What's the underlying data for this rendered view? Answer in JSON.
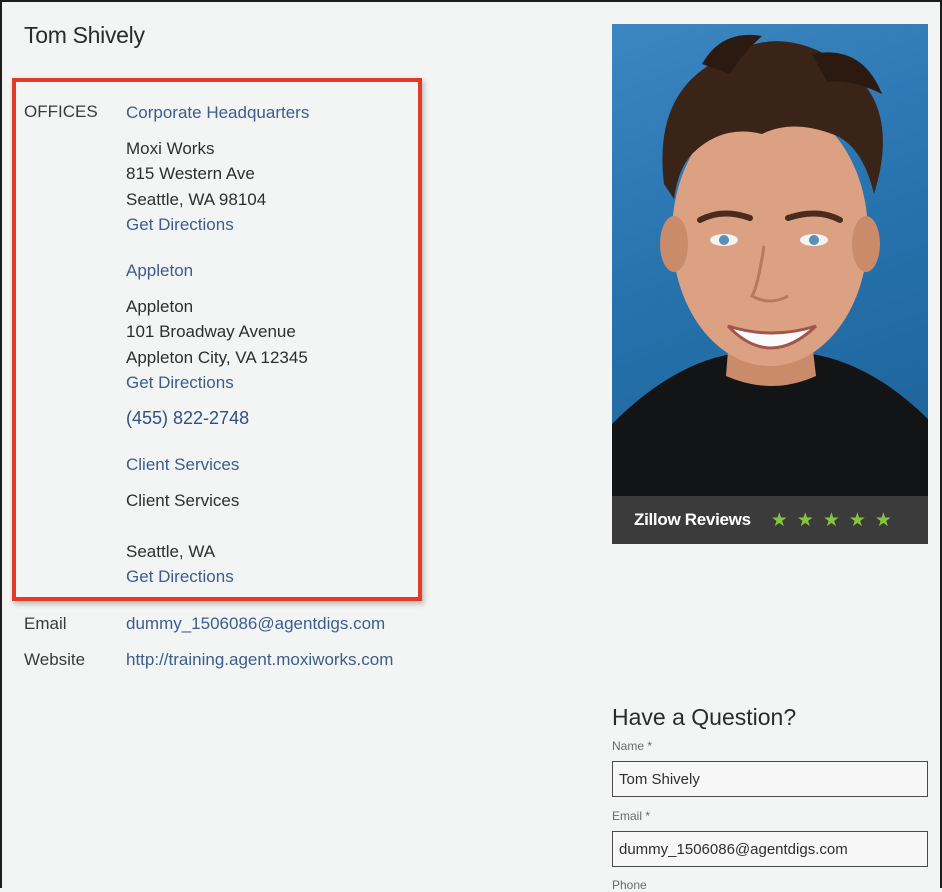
{
  "agent": {
    "name": "Tom Shively"
  },
  "offices": {
    "label": "OFFICES",
    "items": [
      {
        "title": "Corporate Headquarters",
        "lines": [
          "Moxi Works",
          "815 Western Ave",
          "Seattle, WA 98104"
        ],
        "directions": "Get Directions"
      },
      {
        "title": "Appleton",
        "lines": [
          "Appleton",
          "101 Broadway Avenue",
          "Appleton City, VA 12345"
        ],
        "directions": "Get Directions",
        "phone": "(455) 822-2748"
      },
      {
        "title": "Client Services",
        "lines": [
          "Client Services",
          "",
          "Seattle, WA"
        ],
        "directions": "Get Directions"
      }
    ]
  },
  "contact": {
    "email_label": "Email",
    "email": "dummy_1506086@agentdigs.com",
    "website_label": "Website",
    "website": "http://training.agent.moxiworks.com"
  },
  "reviews": {
    "label": "Zillow Reviews",
    "rating_stars": 5,
    "star_color": "#86c440"
  },
  "question_form": {
    "title": "Have a Question?",
    "name_label": "Name *",
    "name_value": "Tom Shively",
    "email_label": "Email *",
    "email_value": "dummy_1506086@agentdigs.com",
    "phone_label": "Phone"
  },
  "colors": {
    "link": "#3c5d8c",
    "highlight": "#e33a2a",
    "background": "#f3f4f4"
  }
}
